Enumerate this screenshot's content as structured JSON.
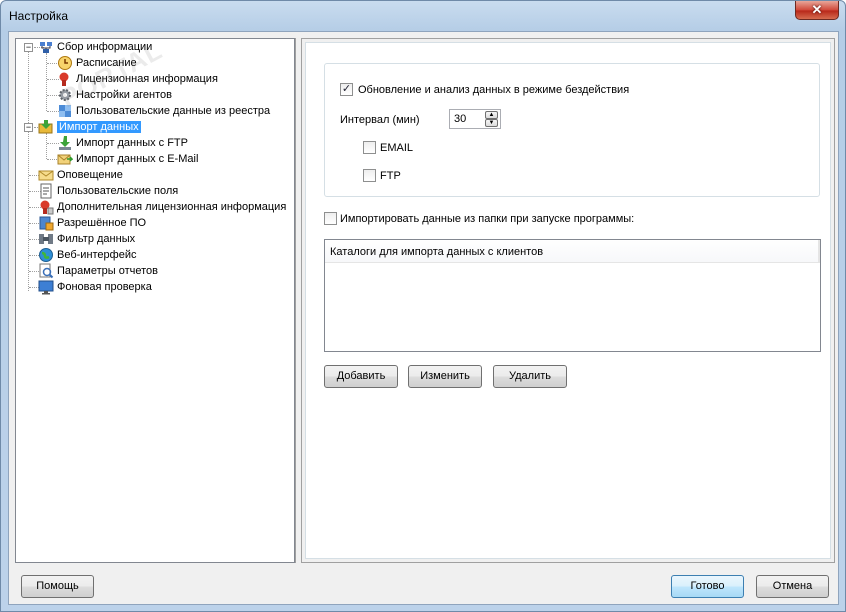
{
  "window": {
    "title": "Настройка",
    "close_glyph": "✕"
  },
  "tree": {
    "items": [
      {
        "label": "Сбор информации",
        "icon": "network-icon"
      },
      {
        "label": "Расписание",
        "icon": "clock-icon"
      },
      {
        "label": "Лицензионная информация",
        "icon": "license-icon"
      },
      {
        "label": "Настройки агентов",
        "icon": "gear-icon"
      },
      {
        "label": "Пользовательские данные из реестра",
        "icon": "registry-icon"
      },
      {
        "label": "Импорт данных",
        "icon": "import-icon"
      },
      {
        "label": "Импорт данных с FTP",
        "icon": "ftp-icon"
      },
      {
        "label": "Импорт данных с E-Mail",
        "icon": "email-import-icon"
      },
      {
        "label": "Оповещение",
        "icon": "envelope-icon"
      },
      {
        "label": "Пользовательские поля",
        "icon": "document-icon"
      },
      {
        "label": "Дополнительная лицензионная информация",
        "icon": "license-extra-icon"
      },
      {
        "label": "Разрешённое ПО",
        "icon": "software-icon"
      },
      {
        "label": "Фильтр данных",
        "icon": "filter-icon"
      },
      {
        "label": "Веб-интерфейс",
        "icon": "globe-icon"
      },
      {
        "label": "Параметры отчетов",
        "icon": "report-icon"
      },
      {
        "label": "Фоновая проверка",
        "icon": "monitor-icon"
      }
    ],
    "selected": "Импорт данных"
  },
  "settings": {
    "idle_update_label": "Обновление и анализ данных в режиме бездействия",
    "idle_update_checked": true,
    "interval_label": "Интервал (мин)",
    "interval_value": "30",
    "email_label": "EMAIL",
    "email_checked": false,
    "ftp_label": "FTP",
    "ftp_checked": false,
    "import_folder_label": "Импортировать данные из папки при запуске программы:",
    "import_folder_checked": false,
    "catalog_header": "Каталоги для импорта данных с клиентов",
    "check_glyph": "✓"
  },
  "buttons": {
    "add": "Добавить",
    "edit": "Изменить",
    "delete": "Удалить",
    "help": "Помощь",
    "ok": "Готово",
    "cancel": "Отмена"
  },
  "colors": {
    "selection": "#3399ff",
    "titlebar": "#b5cde6",
    "close": "#c7402d"
  }
}
